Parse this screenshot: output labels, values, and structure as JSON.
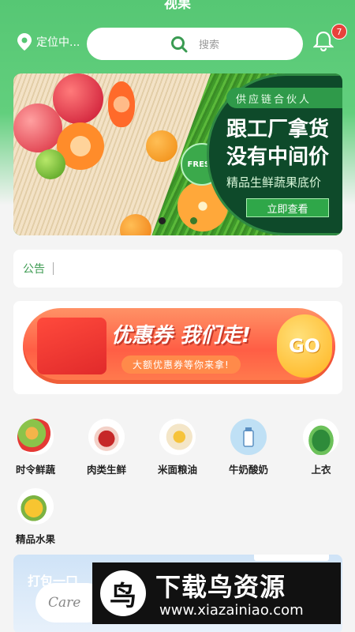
{
  "header": {
    "title": "视果",
    "location_label": "定位中...",
    "search_placeholder": "搜索",
    "notification_count": "7"
  },
  "banner": {
    "tag": "供应链合伙人",
    "headline_1": "跟工厂拿货",
    "headline_2": "没有中间价",
    "subline": "精品生鲜蔬果底价",
    "cta": "立即查看",
    "badge": "FRESH"
  },
  "notice": {
    "label": "公告"
  },
  "coupon": {
    "title": "优惠券 我们走!",
    "subtitle": "大额优惠券等你来拿!",
    "go": "GO"
  },
  "categories": [
    {
      "label": "时令鲜蔬",
      "icon": "vegetables-icon"
    },
    {
      "label": "肉类生鲜",
      "icon": "meat-icon"
    },
    {
      "label": "米面粮油",
      "icon": "grain-oil-icon"
    },
    {
      "label": "牛奶酸奶",
      "icon": "milk-icon"
    },
    {
      "label": "上衣",
      "icon": "leafy-greens-icon"
    },
    {
      "label": "精品水果",
      "icon": "pineapple-icon"
    }
  ],
  "promo": {
    "text": "打包一口",
    "care": "Care"
  },
  "watermark": {
    "logo_glyph": "鸟",
    "title": "下载鸟资源",
    "url": "www.xiazainiao.com"
  },
  "colors": {
    "brand_green": "#56c774",
    "badge_red": "#e8423b",
    "coupon_orange": "#ff5e45"
  }
}
